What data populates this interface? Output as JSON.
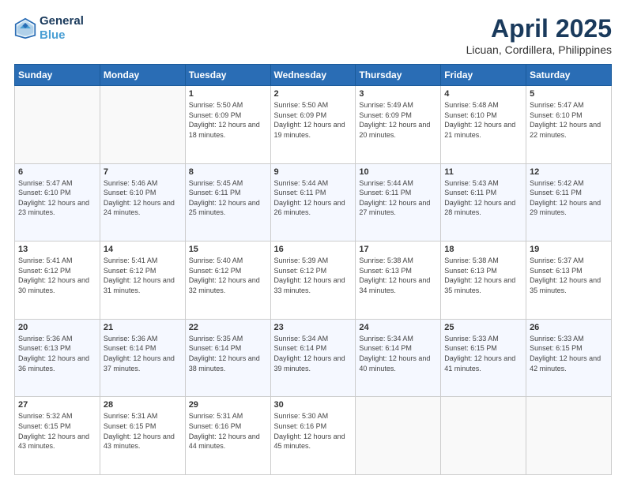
{
  "header": {
    "logo_line1": "General",
    "logo_line2": "Blue",
    "title": "April 2025",
    "subtitle": "Licuan, Cordillera, Philippines"
  },
  "calendar": {
    "days_of_week": [
      "Sunday",
      "Monday",
      "Tuesday",
      "Wednesday",
      "Thursday",
      "Friday",
      "Saturday"
    ],
    "weeks": [
      [
        {
          "day": "",
          "sunrise": "",
          "sunset": "",
          "daylight": ""
        },
        {
          "day": "",
          "sunrise": "",
          "sunset": "",
          "daylight": ""
        },
        {
          "day": "1",
          "sunrise": "Sunrise: 5:50 AM",
          "sunset": "Sunset: 6:09 PM",
          "daylight": "Daylight: 12 hours and 18 minutes."
        },
        {
          "day": "2",
          "sunrise": "Sunrise: 5:50 AM",
          "sunset": "Sunset: 6:09 PM",
          "daylight": "Daylight: 12 hours and 19 minutes."
        },
        {
          "day": "3",
          "sunrise": "Sunrise: 5:49 AM",
          "sunset": "Sunset: 6:09 PM",
          "daylight": "Daylight: 12 hours and 20 minutes."
        },
        {
          "day": "4",
          "sunrise": "Sunrise: 5:48 AM",
          "sunset": "Sunset: 6:10 PM",
          "daylight": "Daylight: 12 hours and 21 minutes."
        },
        {
          "day": "5",
          "sunrise": "Sunrise: 5:47 AM",
          "sunset": "Sunset: 6:10 PM",
          "daylight": "Daylight: 12 hours and 22 minutes."
        }
      ],
      [
        {
          "day": "6",
          "sunrise": "Sunrise: 5:47 AM",
          "sunset": "Sunset: 6:10 PM",
          "daylight": "Daylight: 12 hours and 23 minutes."
        },
        {
          "day": "7",
          "sunrise": "Sunrise: 5:46 AM",
          "sunset": "Sunset: 6:10 PM",
          "daylight": "Daylight: 12 hours and 24 minutes."
        },
        {
          "day": "8",
          "sunrise": "Sunrise: 5:45 AM",
          "sunset": "Sunset: 6:11 PM",
          "daylight": "Daylight: 12 hours and 25 minutes."
        },
        {
          "day": "9",
          "sunrise": "Sunrise: 5:44 AM",
          "sunset": "Sunset: 6:11 PM",
          "daylight": "Daylight: 12 hours and 26 minutes."
        },
        {
          "day": "10",
          "sunrise": "Sunrise: 5:44 AM",
          "sunset": "Sunset: 6:11 PM",
          "daylight": "Daylight: 12 hours and 27 minutes."
        },
        {
          "day": "11",
          "sunrise": "Sunrise: 5:43 AM",
          "sunset": "Sunset: 6:11 PM",
          "daylight": "Daylight: 12 hours and 28 minutes."
        },
        {
          "day": "12",
          "sunrise": "Sunrise: 5:42 AM",
          "sunset": "Sunset: 6:11 PM",
          "daylight": "Daylight: 12 hours and 29 minutes."
        }
      ],
      [
        {
          "day": "13",
          "sunrise": "Sunrise: 5:41 AM",
          "sunset": "Sunset: 6:12 PM",
          "daylight": "Daylight: 12 hours and 30 minutes."
        },
        {
          "day": "14",
          "sunrise": "Sunrise: 5:41 AM",
          "sunset": "Sunset: 6:12 PM",
          "daylight": "Daylight: 12 hours and 31 minutes."
        },
        {
          "day": "15",
          "sunrise": "Sunrise: 5:40 AM",
          "sunset": "Sunset: 6:12 PM",
          "daylight": "Daylight: 12 hours and 32 minutes."
        },
        {
          "day": "16",
          "sunrise": "Sunrise: 5:39 AM",
          "sunset": "Sunset: 6:12 PM",
          "daylight": "Daylight: 12 hours and 33 minutes."
        },
        {
          "day": "17",
          "sunrise": "Sunrise: 5:38 AM",
          "sunset": "Sunset: 6:13 PM",
          "daylight": "Daylight: 12 hours and 34 minutes."
        },
        {
          "day": "18",
          "sunrise": "Sunrise: 5:38 AM",
          "sunset": "Sunset: 6:13 PM",
          "daylight": "Daylight: 12 hours and 35 minutes."
        },
        {
          "day": "19",
          "sunrise": "Sunrise: 5:37 AM",
          "sunset": "Sunset: 6:13 PM",
          "daylight": "Daylight: 12 hours and 35 minutes."
        }
      ],
      [
        {
          "day": "20",
          "sunrise": "Sunrise: 5:36 AM",
          "sunset": "Sunset: 6:13 PM",
          "daylight": "Daylight: 12 hours and 36 minutes."
        },
        {
          "day": "21",
          "sunrise": "Sunrise: 5:36 AM",
          "sunset": "Sunset: 6:14 PM",
          "daylight": "Daylight: 12 hours and 37 minutes."
        },
        {
          "day": "22",
          "sunrise": "Sunrise: 5:35 AM",
          "sunset": "Sunset: 6:14 PM",
          "daylight": "Daylight: 12 hours and 38 minutes."
        },
        {
          "day": "23",
          "sunrise": "Sunrise: 5:34 AM",
          "sunset": "Sunset: 6:14 PM",
          "daylight": "Daylight: 12 hours and 39 minutes."
        },
        {
          "day": "24",
          "sunrise": "Sunrise: 5:34 AM",
          "sunset": "Sunset: 6:14 PM",
          "daylight": "Daylight: 12 hours and 40 minutes."
        },
        {
          "day": "25",
          "sunrise": "Sunrise: 5:33 AM",
          "sunset": "Sunset: 6:15 PM",
          "daylight": "Daylight: 12 hours and 41 minutes."
        },
        {
          "day": "26",
          "sunrise": "Sunrise: 5:33 AM",
          "sunset": "Sunset: 6:15 PM",
          "daylight": "Daylight: 12 hours and 42 minutes."
        }
      ],
      [
        {
          "day": "27",
          "sunrise": "Sunrise: 5:32 AM",
          "sunset": "Sunset: 6:15 PM",
          "daylight": "Daylight: 12 hours and 43 minutes."
        },
        {
          "day": "28",
          "sunrise": "Sunrise: 5:31 AM",
          "sunset": "Sunset: 6:15 PM",
          "daylight": "Daylight: 12 hours and 43 minutes."
        },
        {
          "day": "29",
          "sunrise": "Sunrise: 5:31 AM",
          "sunset": "Sunset: 6:16 PM",
          "daylight": "Daylight: 12 hours and 44 minutes."
        },
        {
          "day": "30",
          "sunrise": "Sunrise: 5:30 AM",
          "sunset": "Sunset: 6:16 PM",
          "daylight": "Daylight: 12 hours and 45 minutes."
        },
        {
          "day": "",
          "sunrise": "",
          "sunset": "",
          "daylight": ""
        },
        {
          "day": "",
          "sunrise": "",
          "sunset": "",
          "daylight": ""
        },
        {
          "day": "",
          "sunrise": "",
          "sunset": "",
          "daylight": ""
        }
      ]
    ]
  }
}
